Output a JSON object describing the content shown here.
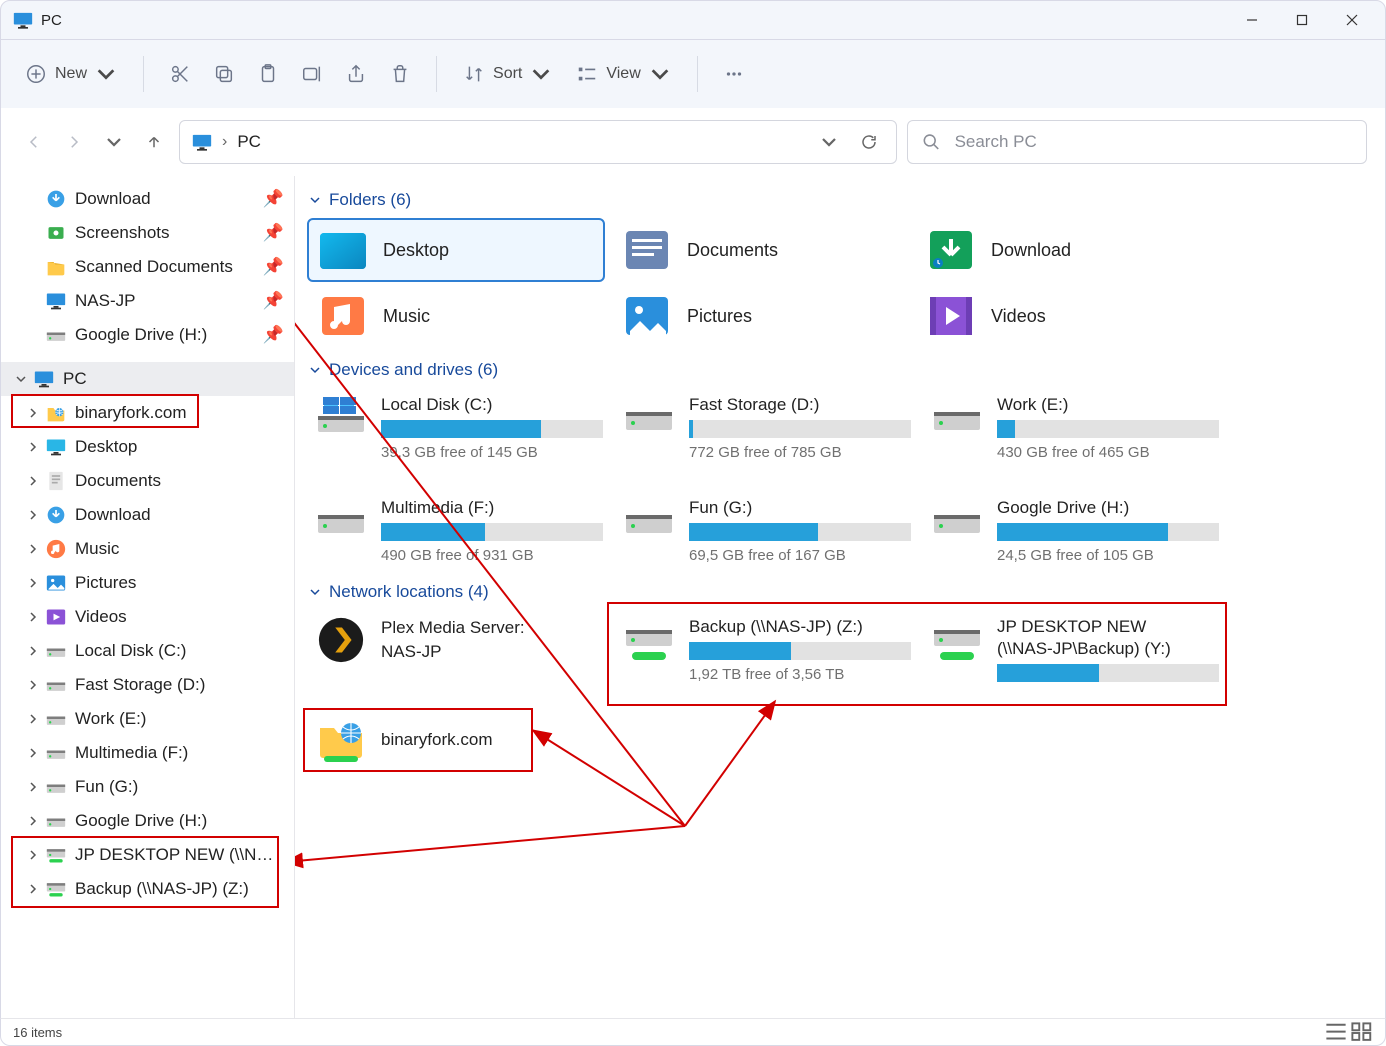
{
  "window": {
    "title": "PC"
  },
  "toolbar": {
    "new": "New",
    "sort": "Sort",
    "view": "View"
  },
  "address": {
    "location": "PC",
    "search_placeholder": "Search PC"
  },
  "sidebar": {
    "pinned": [
      {
        "icon": "download",
        "label": "Download"
      },
      {
        "icon": "screenshots",
        "label": "Screenshots"
      },
      {
        "icon": "folder",
        "label": "Scanned Documents"
      },
      {
        "icon": "monitor",
        "label": "NAS-JP"
      },
      {
        "icon": "drive",
        "label": "Google Drive (H:)"
      }
    ],
    "pc_label": "PC",
    "pc_children": [
      {
        "icon": "netfolder",
        "label": "binaryfork.com"
      },
      {
        "icon": "desktop",
        "label": "Desktop"
      },
      {
        "icon": "documents",
        "label": "Documents"
      },
      {
        "icon": "download",
        "label": "Download"
      },
      {
        "icon": "music",
        "label": "Music"
      },
      {
        "icon": "pictures",
        "label": "Pictures"
      },
      {
        "icon": "videos",
        "label": "Videos"
      },
      {
        "icon": "drive",
        "label": "Local Disk (C:)"
      },
      {
        "icon": "drive",
        "label": "Fast Storage (D:)"
      },
      {
        "icon": "drive",
        "label": "Work (E:)"
      },
      {
        "icon": "drive",
        "label": "Multimedia (F:)"
      },
      {
        "icon": "drive",
        "label": "Fun (G:)"
      },
      {
        "icon": "drive",
        "label": "Google Drive (H:)"
      },
      {
        "icon": "netdrive",
        "label": "JP DESKTOP NEW (\\\\NAS-JP\\Backup) (Y:)"
      },
      {
        "icon": "netdrive",
        "label": "Backup (\\\\NAS-JP) (Z:)"
      }
    ]
  },
  "sections": {
    "folders_head": "Folders (6)",
    "folders": [
      {
        "key": "desktop",
        "label": "Desktop",
        "selected": true
      },
      {
        "key": "documents",
        "label": "Documents"
      },
      {
        "key": "download",
        "label": "Download"
      },
      {
        "key": "music",
        "label": "Music"
      },
      {
        "key": "pictures",
        "label": "Pictures"
      },
      {
        "key": "videos",
        "label": "Videos"
      }
    ],
    "drives_head": "Devices and drives (6)",
    "drives": [
      {
        "name": "Local Disk (C:)",
        "info": "39,3 GB free of 145 GB",
        "pct": 72,
        "icon": "windrive"
      },
      {
        "name": "Fast Storage (D:)",
        "info": "772 GB free of 785 GB",
        "pct": 2,
        "icon": "drive"
      },
      {
        "name": "Work (E:)",
        "info": "430 GB free of 465 GB",
        "pct": 8,
        "icon": "drive"
      },
      {
        "name": "Multimedia (F:)",
        "info": "490 GB free of 931 GB",
        "pct": 47,
        "icon": "drive"
      },
      {
        "name": "Fun (G:)",
        "info": "69,5 GB free of 167 GB",
        "pct": 58,
        "icon": "drive"
      },
      {
        "name": "Google Drive (H:)",
        "info": "24,5 GB free of 105 GB",
        "pct": 77,
        "icon": "drive"
      }
    ],
    "network_head": "Network locations (4)",
    "network": [
      {
        "name1": "Plex Media Server:",
        "name2": "NAS-JP",
        "icon": "plex"
      },
      {
        "name": "Backup (\\\\NAS-JP) (Z:)",
        "info": "1,92 TB free of 3,56 TB",
        "pct": 46,
        "icon": "netdrive"
      },
      {
        "name1": "JP DESKTOP NEW",
        "name2": "(\\\\NAS-JP\\Backup) (Y:)",
        "pct": 46,
        "icon": "netdrive"
      },
      {
        "name": "binaryfork.com",
        "icon": "netfolder"
      }
    ]
  },
  "status": {
    "text": "16 items"
  }
}
